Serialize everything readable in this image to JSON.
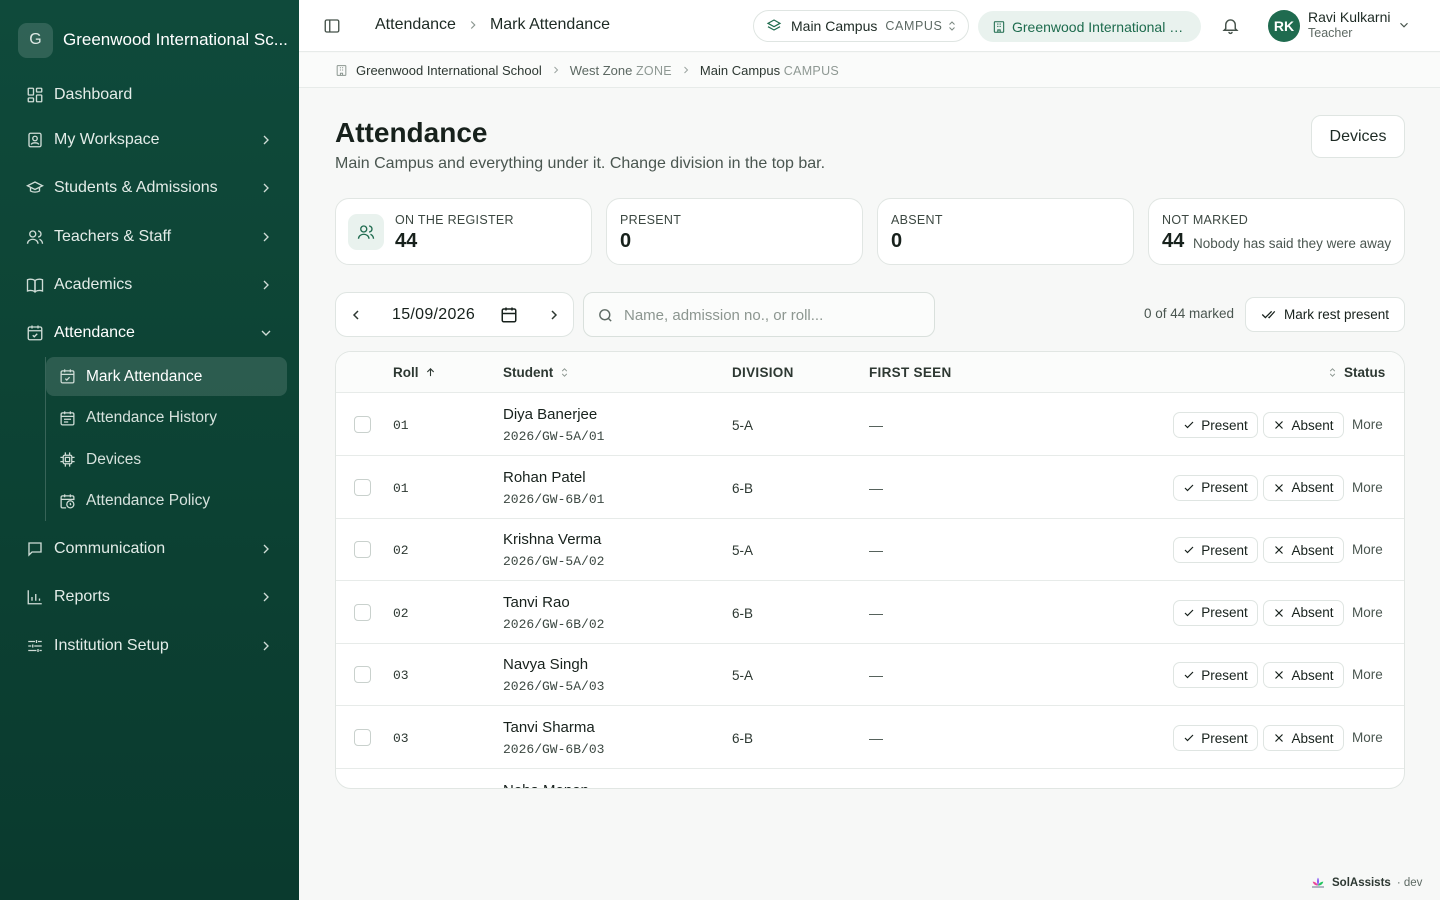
{
  "sidebar": {
    "logo_letter": "G",
    "school_name": "Greenwood International Sc...",
    "items": [
      {
        "label": "Dashboard",
        "icon": "grid-icon"
      },
      {
        "label": "My Workspace",
        "icon": "workspace-icon"
      },
      {
        "label": "Students & Admissions",
        "icon": "graduation-cap-icon"
      },
      {
        "label": "Teachers & Staff",
        "icon": "users-icon"
      },
      {
        "label": "Academics",
        "icon": "book-icon"
      },
      {
        "label": "Attendance",
        "icon": "calendar-check-icon"
      },
      {
        "label": "Communication",
        "icon": "message-icon"
      },
      {
        "label": "Reports",
        "icon": "chart-icon"
      },
      {
        "label": "Institution Setup",
        "icon": "sliders-icon"
      }
    ],
    "attendance_sub": [
      {
        "label": "Mark Attendance",
        "icon": "calendar-check-icon"
      },
      {
        "label": "Attendance History",
        "icon": "calendar-list-icon"
      },
      {
        "label": "Devices",
        "icon": "chip-icon"
      },
      {
        "label": "Attendance Policy",
        "icon": "calendar-clock-icon"
      }
    ]
  },
  "topbar": {
    "crumb_1": "Attendance",
    "crumb_2": "Mark Attendance",
    "campus": "Main Campus",
    "campus_tag": "CAMPUS",
    "school": "Greenwood International School",
    "user_initials": "RK",
    "user_name": "Ravi Kulkarni",
    "user_role": "Teacher"
  },
  "breadcrumb": {
    "school": "Greenwood International School",
    "zone": "West Zone",
    "zone_tag": "ZONE",
    "campus": "Main Campus",
    "campus_tag": "CAMPUS"
  },
  "page": {
    "title": "Attendance",
    "subtitle": "Main Campus and everything under it. Change division in the top bar.",
    "devices_label": "Devices"
  },
  "stats": {
    "register_label": "ON THE REGISTER",
    "register_value": "44",
    "present_label": "PRESENT",
    "present_value": "0",
    "absent_label": "ABSENT",
    "absent_value": "0",
    "not_marked_label": "NOT MARKED",
    "not_marked_value": "44",
    "not_marked_note": "Nobody has said they were away"
  },
  "toolbar": {
    "date": "15/09/2026",
    "search_placeholder": "Name, admission no., or roll...",
    "marked_text": "0 of 44 marked",
    "mark_rest_label": "Mark rest present"
  },
  "table": {
    "headers": {
      "roll": "Roll",
      "student": "Student",
      "division": "DIVISION",
      "first_seen": "FIRST SEEN",
      "status": "Status"
    },
    "present_label": "Present",
    "absent_label": "Absent",
    "more_label": "More",
    "rows": [
      {
        "roll": "01",
        "name": "Diya Banerjee",
        "adm": "2026/GW-5A/01",
        "division": "5-A",
        "first_seen": "—"
      },
      {
        "roll": "01",
        "name": "Rohan Patel",
        "adm": "2026/GW-6B/01",
        "division": "6-B",
        "first_seen": "—"
      },
      {
        "roll": "02",
        "name": "Krishna Verma",
        "adm": "2026/GW-5A/02",
        "division": "5-A",
        "first_seen": "—"
      },
      {
        "roll": "02",
        "name": "Tanvi Rao",
        "adm": "2026/GW-6B/02",
        "division": "6-B",
        "first_seen": "—"
      },
      {
        "roll": "03",
        "name": "Navya Singh",
        "adm": "2026/GW-5A/03",
        "division": "5-A",
        "first_seen": "—"
      },
      {
        "roll": "03",
        "name": "Tanvi Sharma",
        "adm": "2026/GW-6B/03",
        "division": "6-B",
        "first_seen": "—"
      },
      {
        "roll": "",
        "name": "Neha Menon",
        "adm": "",
        "division": "",
        "first_seen": ""
      }
    ]
  },
  "footer": {
    "brand": "SolAssists",
    "env": "· dev"
  },
  "colors": {
    "sidebar_bg": "#0d4435",
    "accent": "#1f6b4f",
    "accent_soft": "#e9f2ee"
  }
}
